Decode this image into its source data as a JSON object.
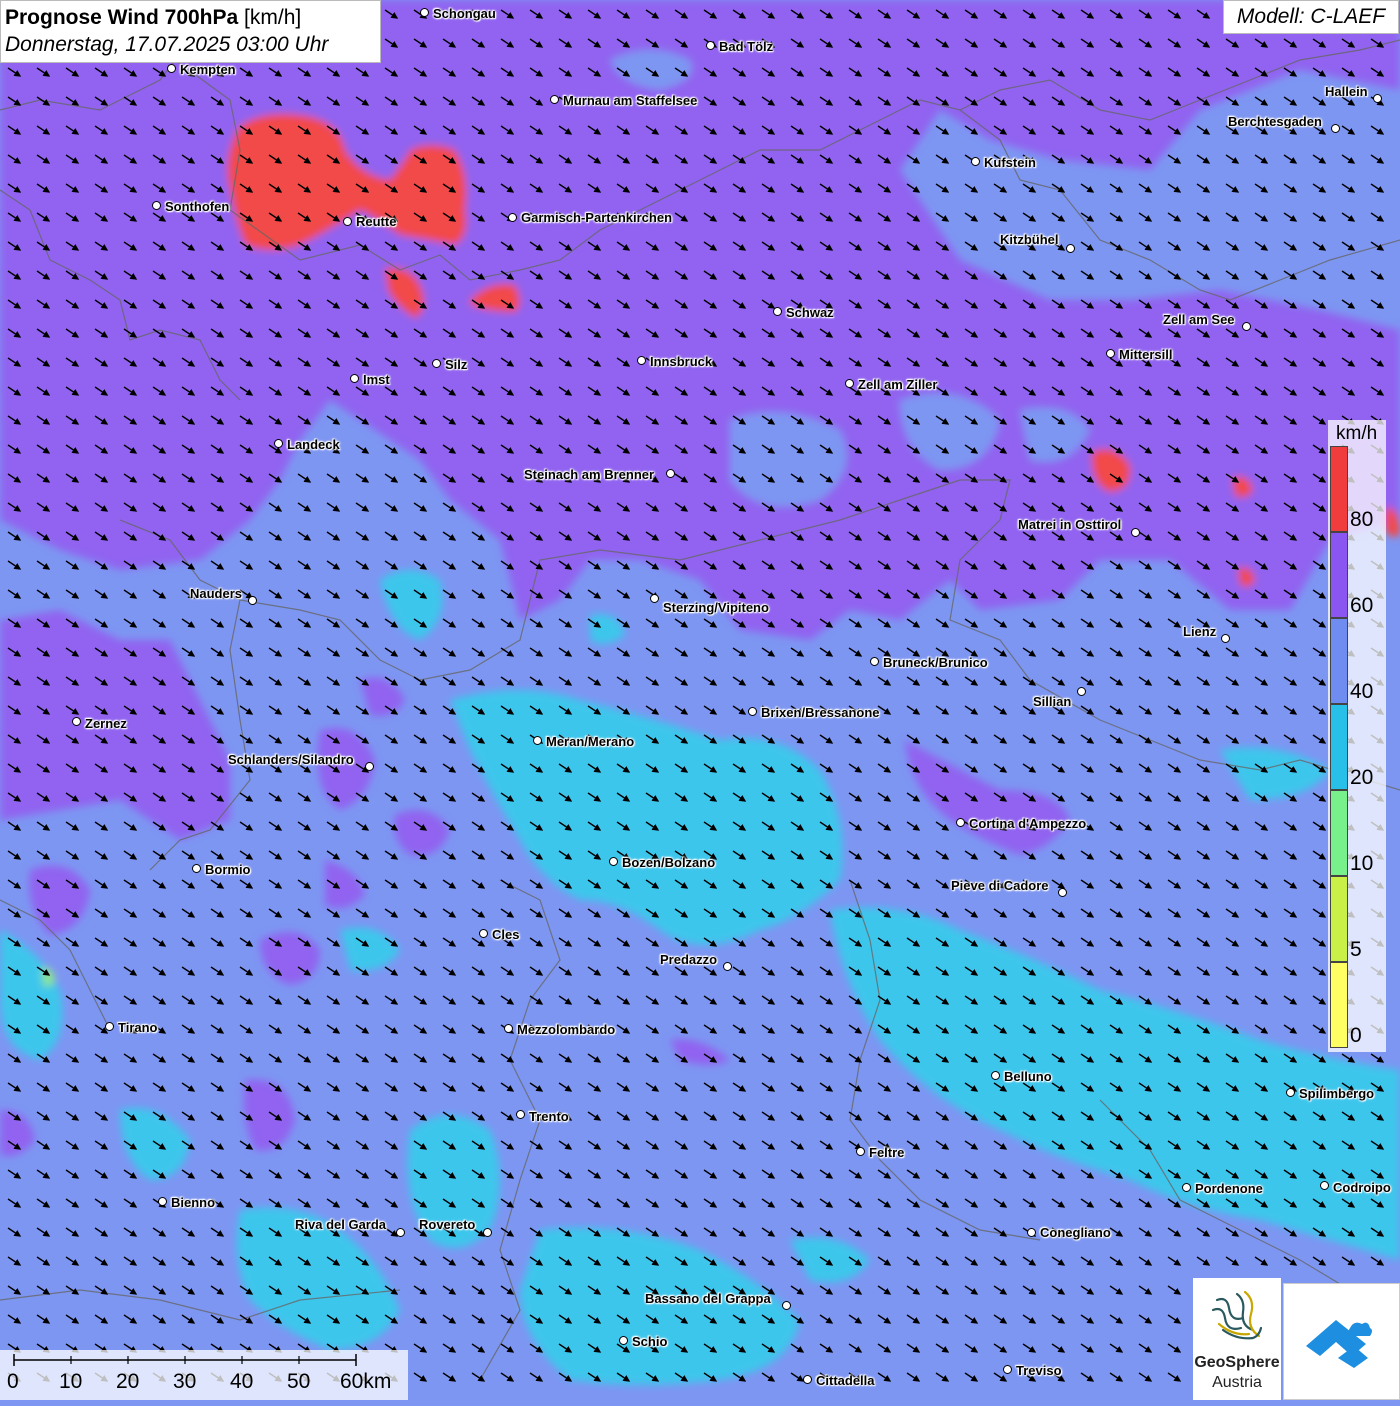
{
  "title": {
    "main_bold": "Prognose Wind 700hPa",
    "unit": "[km/h]",
    "datetime": "Donnerstag, 17.07.2025 03:00 Uhr"
  },
  "model": "Modell: C-LAEF",
  "legend": {
    "unit": "km/h",
    "ticks": [
      "80",
      "60",
      "40",
      "20",
      "10",
      "5",
      "0"
    ],
    "colors": [
      "#f03c3c",
      "#8a55f0",
      "#6f8cf0",
      "#28c0e8",
      "#78f08c",
      "#c8f046",
      "#ffff64"
    ]
  },
  "scalebar": {
    "labels": [
      "0",
      "10",
      "20",
      "30",
      "40",
      "50",
      "60km"
    ]
  },
  "logos": {
    "geosphere_line1": "GeoSphere",
    "geosphere_line2": "Austria"
  },
  "wind_direction": "north-west to south-east",
  "cities": [
    {
      "name": "Schongau"
    },
    {
      "name": "Bad Tölz"
    },
    {
      "name": "Kempten"
    },
    {
      "name": "Murnau am Staffelsee"
    },
    {
      "name": "Hallein"
    },
    {
      "name": "Berchtesgaden"
    },
    {
      "name": "Kufstein"
    },
    {
      "name": "Sonthofen"
    },
    {
      "name": "Reutte"
    },
    {
      "name": "Garmisch-Partenkirchen"
    },
    {
      "name": "Kitzbühel"
    },
    {
      "name": "Schwaz"
    },
    {
      "name": "Zell am See"
    },
    {
      "name": "Mittersill"
    },
    {
      "name": "Innsbruck"
    },
    {
      "name": "Silz"
    },
    {
      "name": "Imst"
    },
    {
      "name": "Zell am Ziller"
    },
    {
      "name": "Landeck"
    },
    {
      "name": "Steinach am Brenner"
    },
    {
      "name": "Matrei in Osttirol"
    },
    {
      "name": "Nauders"
    },
    {
      "name": "Sterzing/Vipiteno"
    },
    {
      "name": "Lienz"
    },
    {
      "name": "Bruneck/Brunico"
    },
    {
      "name": "Sillian"
    },
    {
      "name": "Zernez"
    },
    {
      "name": "Brixen/Bressanone"
    },
    {
      "name": "Meran/Merano"
    },
    {
      "name": "Schlanders/Silandro"
    },
    {
      "name": "Cortina d'Ampezzo"
    },
    {
      "name": "Bozen/Bolzano"
    },
    {
      "name": "Bormio"
    },
    {
      "name": "Pieve di Cadore"
    },
    {
      "name": "Cles"
    },
    {
      "name": "Predazzo"
    },
    {
      "name": "Tirano"
    },
    {
      "name": "Mezzolombardo"
    },
    {
      "name": "Belluno"
    },
    {
      "name": "Spilimbergo"
    },
    {
      "name": "Trento"
    },
    {
      "name": "Feltre"
    },
    {
      "name": "Pordenone"
    },
    {
      "name": "Codroipo"
    },
    {
      "name": "Bienno"
    },
    {
      "name": "Riva del Garda"
    },
    {
      "name": "Rovereto"
    },
    {
      "name": "Conegliano"
    },
    {
      "name": "Bassano del Grappa"
    },
    {
      "name": "Schio"
    },
    {
      "name": "Treviso"
    },
    {
      "name": "Cittadella"
    }
  ]
}
